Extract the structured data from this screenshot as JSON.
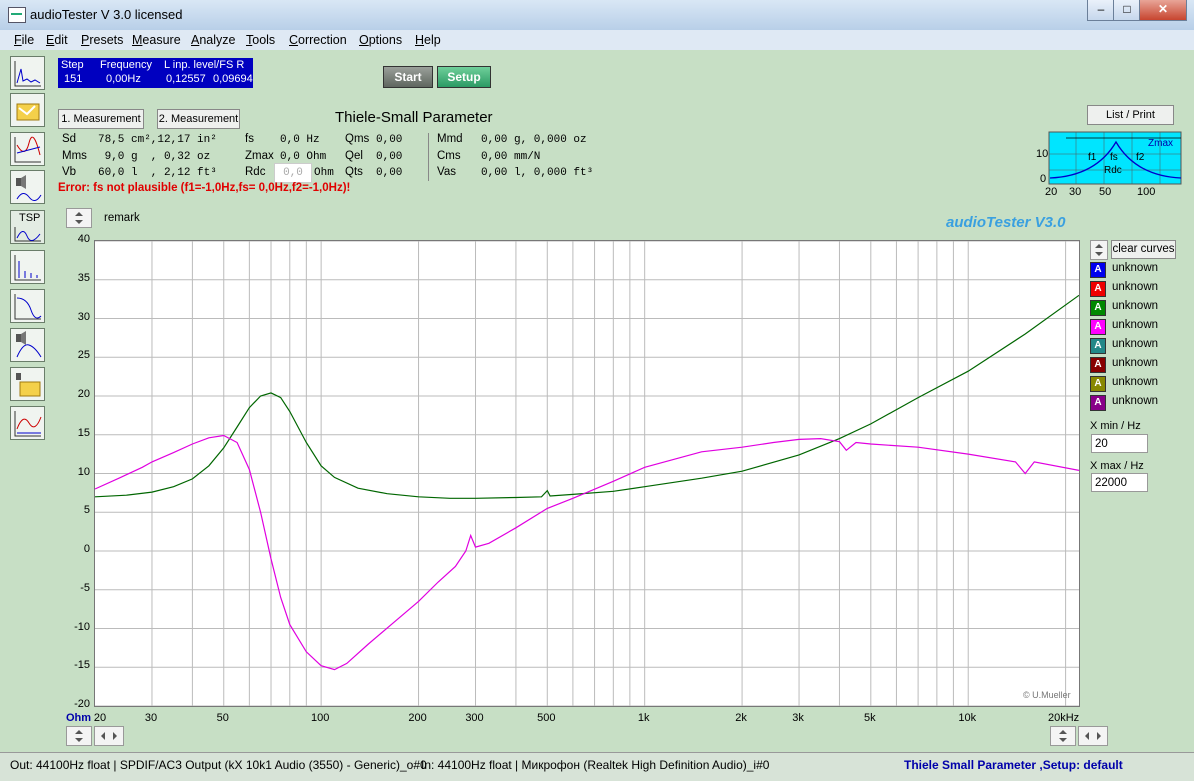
{
  "window": {
    "title": "audioTester  V 3.0   licensed"
  },
  "menu": [
    {
      "label": "File",
      "u": "F",
      "rest": "ile"
    },
    {
      "label": "Edit",
      "u": "E",
      "rest": "dit"
    },
    {
      "label": "Presets",
      "u": "P",
      "rest": "resets"
    },
    {
      "label": "Measure",
      "u": "M",
      "rest": "easure"
    },
    {
      "label": "Analyze",
      "u": "A",
      "rest": "nalyze"
    },
    {
      "label": "Tools",
      "u": "T",
      "rest": "ools"
    },
    {
      "label": "Correction",
      "u": "C",
      "rest": "orrection"
    },
    {
      "label": "Options",
      "u": "O",
      "rest": "ptions"
    },
    {
      "label": "Help",
      "u": "H",
      "rest": "elp"
    }
  ],
  "status": {
    "h_step": "Step",
    "h_freq": "Frequency",
    "h_level": "L  inp. level/FS  R",
    "step": "151",
    "freq": "0,00Hz",
    "level_l": "0,12557",
    "level_r": "0,09694"
  },
  "buttons": {
    "start": "Start",
    "setup": "Setup",
    "meas1": "1. Measurement",
    "meas2": "2. Measurement",
    "list_print": "List / Print",
    "clear_curves": "clear curves",
    "tsp": "TSP"
  },
  "tsp": {
    "title": "Thiele-Small Parameter",
    "sd_l": "Sd",
    "sd_v": "78,5 cm²,12,17 in²",
    "mms_l": "Mms",
    "mms_v": " 9,0 g  , 0,32 oz",
    "vb_l": "Vb",
    "vb_v": "60,0 l  , 2,12 ft³",
    "fs_l": "fs",
    "fs_v": "0,0 Hz",
    "zmax_l": "Zmax",
    "zmax_v": "0,0 Ohm",
    "rdc_l": "Rdc",
    "rdc_v": "0,0",
    "rdc_u": "Ohm",
    "qms_l": "Qms",
    "qms_v": "0,00",
    "qel_l": "Qel",
    "qel_v": "0,00",
    "qts_l": "Qts",
    "qts_v": "0,00",
    "mmd_l": "Mmd",
    "mmd_v": "0,00 g, 0,000 oz",
    "cms_l": "Cms",
    "cms_v": "0,00 mm/N",
    "vas_l": "Vas",
    "vas_v": "0,00 l, 0,000 ft³",
    "error": "Error: fs not plausible (f1=-1,0Hz,fs= 0,0Hz,f2=-1,0Hz)!"
  },
  "mini": {
    "zmax": "Zmax",
    "f1": "f1",
    "fs": "fs",
    "f2": "f2",
    "rdc": "Rdc",
    "y10": "10",
    "y0": "0",
    "x20": "20",
    "x30": "30",
    "x50": "50",
    "x100": "100"
  },
  "plot": {
    "remark": "remark",
    "brand": "audioTester  V3.0",
    "copyright": "© U.Mueller",
    "yunit": "Ohm",
    "xunit": "20kHz"
  },
  "legend": [
    {
      "label": "unknown",
      "letter": "A",
      "color": "#0000ee"
    },
    {
      "label": "unknown",
      "letter": "A",
      "color": "#ee0000"
    },
    {
      "label": "unknown",
      "letter": "A",
      "color": "#008800"
    },
    {
      "label": "unknown",
      "letter": "A",
      "color": "#ff00ff"
    },
    {
      "label": "unknown",
      "letter": "A",
      "color": "#228888"
    },
    {
      "label": "unknown",
      "letter": "A",
      "color": "#880000"
    },
    {
      "label": "unknown",
      "letter": "A",
      "color": "#888800"
    },
    {
      "label": "unknown",
      "letter": "A",
      "color": "#880088"
    }
  ],
  "xrange": {
    "min_label": "min / Hz",
    "min_value": "20",
    "max_label": "max / Hz",
    "max_value": "22000",
    "x": "X"
  },
  "statusbar": {
    "out": "Out: 44100Hz float  | SPDIF/AC3 Output (kX 10k1 Audio (3550) - Generic)_o#0",
    "in": "In: 44100Hz float  | Микрофон (Realtek High Definition Audio)_i#0",
    "mode": "Thiele Small Parameter ,Setup:  default"
  },
  "chart_data": {
    "type": "line",
    "xscale": "log",
    "xlim": [
      20,
      22000
    ],
    "ylim": [
      -20,
      40
    ],
    "grid": true,
    "yticks": [
      40,
      35,
      30,
      25,
      20,
      15,
      10,
      5,
      0,
      -5,
      -10,
      -15,
      -20
    ],
    "xticks": [
      {
        "v": 30,
        "t": "30"
      },
      {
        "v": 50,
        "t": "50"
      },
      {
        "v": 100,
        "t": "100"
      },
      {
        "v": 200,
        "t": "200"
      },
      {
        "v": 300,
        "t": "300"
      },
      {
        "v": 500,
        "t": "500"
      },
      {
        "v": 1000,
        "t": "1k"
      },
      {
        "v": 2000,
        "t": "2k"
      },
      {
        "v": 3000,
        "t": "3k"
      },
      {
        "v": 5000,
        "t": "5k"
      },
      {
        "v": 10000,
        "t": "10k"
      }
    ],
    "xtick_first": "20",
    "series": [
      {
        "color": "#006600",
        "points": [
          [
            20,
            7.0
          ],
          [
            25,
            7.2
          ],
          [
            30,
            7.6
          ],
          [
            35,
            8.3
          ],
          [
            40,
            9.3
          ],
          [
            45,
            11.0
          ],
          [
            50,
            13.3
          ],
          [
            55,
            16.0
          ],
          [
            60,
            18.5
          ],
          [
            65,
            20.0
          ],
          [
            70,
            20.4
          ],
          [
            75,
            19.8
          ],
          [
            80,
            18.0
          ],
          [
            90,
            14.0
          ],
          [
            100,
            11.0
          ],
          [
            110,
            9.5
          ],
          [
            130,
            8.1
          ],
          [
            160,
            7.4
          ],
          [
            200,
            7.0
          ],
          [
            250,
            6.8
          ],
          [
            300,
            6.8
          ],
          [
            400,
            6.9
          ],
          [
            480,
            7.0
          ],
          [
            500,
            7.8
          ],
          [
            510,
            7.1
          ],
          [
            600,
            7.3
          ],
          [
            800,
            7.7
          ],
          [
            1000,
            8.3
          ],
          [
            1500,
            9.4
          ],
          [
            2000,
            10.3
          ],
          [
            3000,
            12.4
          ],
          [
            4000,
            14.5
          ],
          [
            5000,
            16.4
          ],
          [
            7000,
            19.8
          ],
          [
            10000,
            23.2
          ],
          [
            15000,
            28.0
          ],
          [
            22000,
            33.0
          ]
        ]
      },
      {
        "color": "#e000e0",
        "points": [
          [
            20,
            8.0
          ],
          [
            24,
            9.5
          ],
          [
            28,
            10.8
          ],
          [
            30,
            11.5
          ],
          [
            35,
            12.7
          ],
          [
            40,
            13.8
          ],
          [
            45,
            14.6
          ],
          [
            50,
            14.9
          ],
          [
            55,
            14.0
          ],
          [
            60,
            10.5
          ],
          [
            65,
            5.0
          ],
          [
            70,
            -1.0
          ],
          [
            75,
            -6.0
          ],
          [
            80,
            -9.5
          ],
          [
            90,
            -13.0
          ],
          [
            100,
            -14.8
          ],
          [
            110,
            -15.3
          ],
          [
            120,
            -14.5
          ],
          [
            140,
            -12.0
          ],
          [
            170,
            -9.0
          ],
          [
            200,
            -6.5
          ],
          [
            230,
            -4.0
          ],
          [
            260,
            -2.0
          ],
          [
            280,
            0.0
          ],
          [
            290,
            2.0
          ],
          [
            300,
            0.5
          ],
          [
            330,
            1.0
          ],
          [
            400,
            3.0
          ],
          [
            500,
            5.5
          ],
          [
            600,
            6.8
          ],
          [
            800,
            9.0
          ],
          [
            1000,
            10.8
          ],
          [
            1500,
            12.8
          ],
          [
            2000,
            13.4
          ],
          [
            2500,
            14.0
          ],
          [
            3000,
            14.4
          ],
          [
            3500,
            14.5
          ],
          [
            4000,
            14.1
          ],
          [
            4200,
            13.0
          ],
          [
            4500,
            14.0
          ],
          [
            5000,
            13.8
          ],
          [
            7000,
            13.4
          ],
          [
            10000,
            12.5
          ],
          [
            14000,
            11.5
          ],
          [
            15000,
            10.0
          ],
          [
            16000,
            11.5
          ],
          [
            22000,
            10.4
          ]
        ]
      }
    ]
  }
}
